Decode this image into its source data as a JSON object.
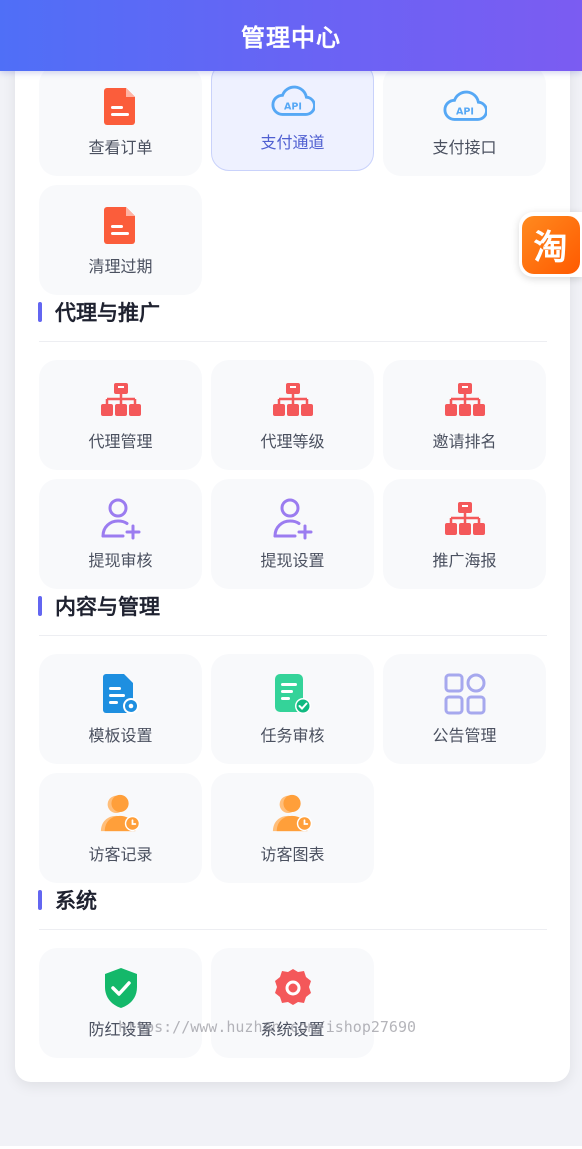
{
  "header": {
    "title": "管理中心"
  },
  "top_row": [
    {
      "label": "查看订单",
      "icon": "document-icon",
      "active": false
    },
    {
      "label": "支付通道",
      "icon": "api-cloud-icon",
      "active": true
    },
    {
      "label": "支付接口",
      "icon": "api-cloud-icon",
      "active": false
    }
  ],
  "top_row2": [
    {
      "label": "清理过期",
      "icon": "document-icon"
    }
  ],
  "sections": {
    "agent": {
      "title": "代理与推广",
      "items": [
        {
          "label": "代理管理",
          "icon": "org-chart-icon"
        },
        {
          "label": "代理等级",
          "icon": "org-chart-icon"
        },
        {
          "label": "邀请排名",
          "icon": "org-chart-icon"
        },
        {
          "label": "提现审核",
          "icon": "user-add-icon"
        },
        {
          "label": "提现设置",
          "icon": "user-add-icon"
        },
        {
          "label": "推广海报",
          "icon": "org-chart-icon"
        }
      ]
    },
    "content": {
      "title": "内容与管理",
      "items": [
        {
          "label": "模板设置",
          "icon": "file-gear-icon"
        },
        {
          "label": "任务审核",
          "icon": "file-check-icon"
        },
        {
          "label": "公告管理",
          "icon": "grid-apps-icon"
        },
        {
          "label": "访客记录",
          "icon": "user-clock-icon"
        },
        {
          "label": "访客图表",
          "icon": "user-clock-icon"
        }
      ]
    },
    "system": {
      "title": "系统",
      "items": [
        {
          "label": "防红设置",
          "icon": "shield-check-icon"
        },
        {
          "label": "系统设置",
          "icon": "gear-icon"
        }
      ]
    }
  },
  "float_badge": {
    "text": "淘"
  },
  "watermark": "https://www.huzhan.com/ishop27690",
  "colors": {
    "header_start": "#4f6ff7",
    "header_end": "#7b5cf2",
    "accent": "#6366f1",
    "doc_orange": "#fb5d3b",
    "api_blue": "#56a8f5",
    "org_red": "#f4585a",
    "user_purple": "#9b7cf0",
    "file_blue": "#1e8fe0",
    "file_green": "#34d399",
    "grid_lilac": "#a6a8ee",
    "visitor_orange": "#ff9f3a",
    "shield_green": "#14b86a",
    "gear_red": "#f4585a"
  }
}
